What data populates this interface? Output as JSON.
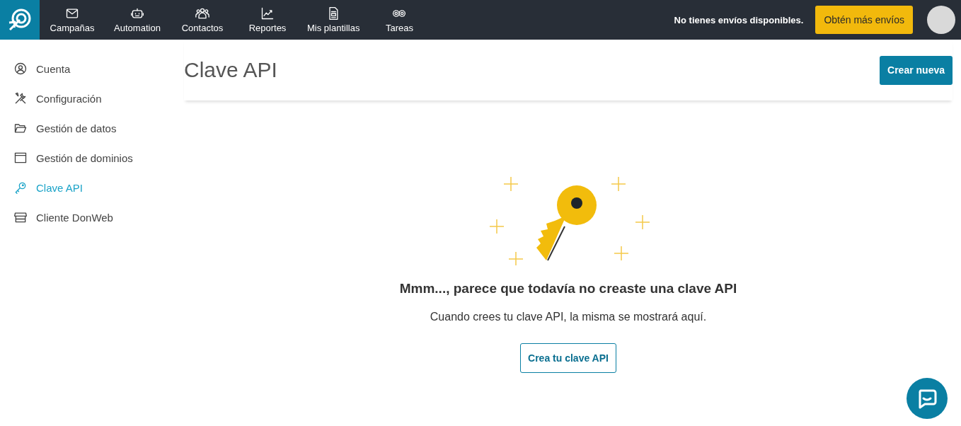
{
  "nav": [
    {
      "label": "Campañas"
    },
    {
      "label": "Automation"
    },
    {
      "label": "Contactos"
    },
    {
      "label": "Reportes"
    },
    {
      "label": "Mis plantillas"
    },
    {
      "label": "Tareas"
    }
  ],
  "notice": "No tienes envíos disponibles.",
  "upgrade_button": "Obtén más envíos",
  "sidebar": {
    "items": [
      {
        "label": "Cuenta",
        "selected": false
      },
      {
        "label": "Configuración",
        "selected": false
      },
      {
        "label": "Gestión de datos",
        "selected": false
      },
      {
        "label": "Gestión de dominios",
        "selected": false
      },
      {
        "label": "Clave API",
        "selected": true
      },
      {
        "label": "Cliente DonWeb",
        "selected": false
      }
    ]
  },
  "page": {
    "title": "Clave API",
    "create_button": "Crear nueva"
  },
  "empty_state": {
    "heading": "Mmm..., parece que todavía no creaste una clave API",
    "text": "Cuando crees tu clave API, la misma se mostrará aquí.",
    "button": "Crea tu clave API"
  }
}
